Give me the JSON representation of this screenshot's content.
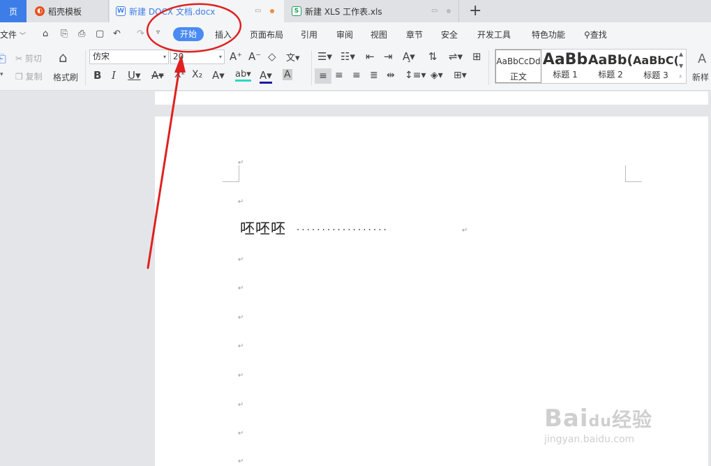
{
  "tabs": [
    {
      "label": "页"
    },
    {
      "label": "稻壳模板",
      "icon": "daoke-icon"
    },
    {
      "label": "新建 DOCX 文档.docx",
      "icon": "word-icon"
    },
    {
      "label": "新建 XLS 工作表.xls",
      "icon": "excel-icon"
    }
  ],
  "tab_icon_letters": {
    "word": "W",
    "excel": "S"
  },
  "menubar": {
    "file": "文件",
    "items": [
      "开始",
      "插入",
      "页面布局",
      "引用",
      "审阅",
      "视图",
      "章节",
      "安全",
      "开发工具",
      "特色功能"
    ],
    "search": "查找"
  },
  "ribbon": {
    "cut": "剪切",
    "copy": "复制",
    "format_painter": "格式刷",
    "font_name": "仿宋",
    "font_size": "20",
    "styles": [
      {
        "sample": "AaBbCcDd",
        "label": "正文"
      },
      {
        "sample": "AaBb",
        "label": "标题 1"
      },
      {
        "sample": "AaBb(",
        "label": "标题 2"
      },
      {
        "sample": "AaBbC(",
        "label": "标题 3"
      }
    ],
    "new_style": "新样"
  },
  "document": {
    "body_text": "呸呸呸",
    "leader": "..................",
    "para_mark": "↵"
  },
  "watermark": {
    "main": "Bai",
    "paw": "du",
    "cn": "经验",
    "sub": "jingyan.baidu.com"
  },
  "colors": {
    "accent": "#4a8af4",
    "annotation": "#e02020",
    "wps_blue": "#3d7de8"
  }
}
